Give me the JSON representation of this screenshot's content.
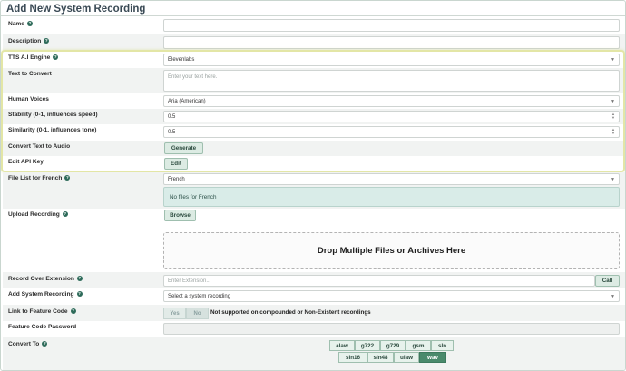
{
  "page": {
    "title": "Add New System Recording"
  },
  "form": {
    "name": {
      "label": "Name",
      "value": ""
    },
    "description": {
      "label": "Description",
      "value": ""
    },
    "tts_engine": {
      "label": "TTS A.I Engine",
      "value": "Elevenlabs"
    },
    "text_to_convert": {
      "label": "Text to Convert",
      "placeholder": "Enter your text here."
    },
    "human_voices": {
      "label": "Human Voices",
      "value": "Aria (American)"
    },
    "stability": {
      "label": "Stability (0-1, influences speed)",
      "value": "0.5"
    },
    "similarity": {
      "label": "Similarity (0-1, influences tone)",
      "value": "0.5"
    },
    "convert": {
      "label": "Convert Text to Audio",
      "button": "Generate"
    },
    "api_key": {
      "label": "Edit API Key",
      "button": "Edit"
    },
    "file_list": {
      "label": "File List for French",
      "value": "French",
      "empty_text": "No files for French"
    },
    "upload": {
      "label": "Upload Recording",
      "button": "Browse",
      "drop_text": "Drop Multiple Files or Archives Here"
    },
    "record_over": {
      "label": "Record Over Extension",
      "placeholder": "Enter Extension...",
      "button": "Call"
    },
    "add_system_recording": {
      "label": "Add System Recording",
      "value": "Select a system recording"
    },
    "link_feature_code": {
      "label": "Link to Feature Code",
      "yes": "Yes",
      "no": "No",
      "note": "Not supported on compounded or Non-Existent recordings"
    },
    "feature_code_password": {
      "label": "Feature Code Password",
      "value": ""
    },
    "convert_to": {
      "label": "Convert To",
      "row1": [
        "alaw",
        "g722",
        "g729",
        "gsm",
        "sln"
      ],
      "row2": [
        "sln16",
        "sln48",
        "ulaw",
        "wav"
      ],
      "selected": "wav"
    }
  },
  "colors": {
    "accent": "#4a8a6c",
    "highlight_border": "#e3e6a6",
    "help_icon": "#2e6b5a"
  }
}
